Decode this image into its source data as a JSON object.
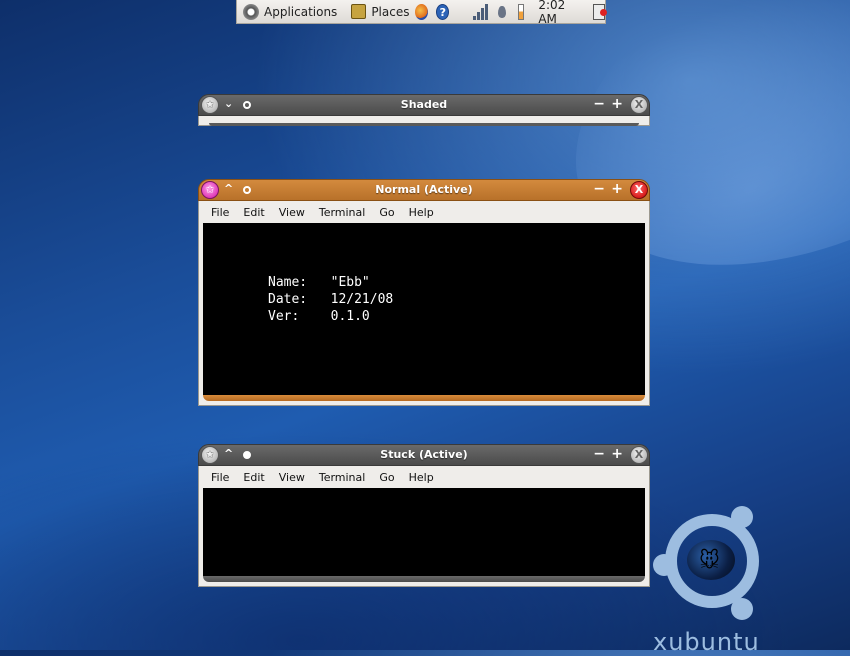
{
  "panel": {
    "applications_label": "Applications",
    "places_label": "Places",
    "help_glyph": "?",
    "clock": "2:02 AM",
    "icons": [
      "applications-icon",
      "places-icon",
      "firefox-icon",
      "help-icon",
      "network-signal-icon",
      "volume-icon",
      "battery-icon",
      "logout-icon"
    ]
  },
  "windows": {
    "shaded": {
      "title": "Shaded"
    },
    "normal": {
      "title": "Normal (Active)",
      "menu": [
        "File",
        "Edit",
        "View",
        "Terminal",
        "Go",
        "Help"
      ],
      "terminal_lines": [
        "Name:   \"Ebb\"",
        "Date:   12/21/08",
        "Ver:    0.1.0"
      ]
    },
    "stuck": {
      "title": "Stuck (Active)",
      "menu": [
        "File",
        "Edit",
        "View",
        "Terminal",
        "Go",
        "Help"
      ]
    }
  },
  "buttons": {
    "minimize": "−",
    "maximize": "+",
    "close": "X",
    "shade_down": "⌄",
    "shade_up": "^",
    "menu_star": "✩"
  },
  "logo": {
    "text": "xubuntu"
  },
  "colors": {
    "active_title": "#c77d33",
    "inactive_title": "#555555",
    "close_active": "#d81b1b",
    "menu_active": "#e03bb8"
  }
}
